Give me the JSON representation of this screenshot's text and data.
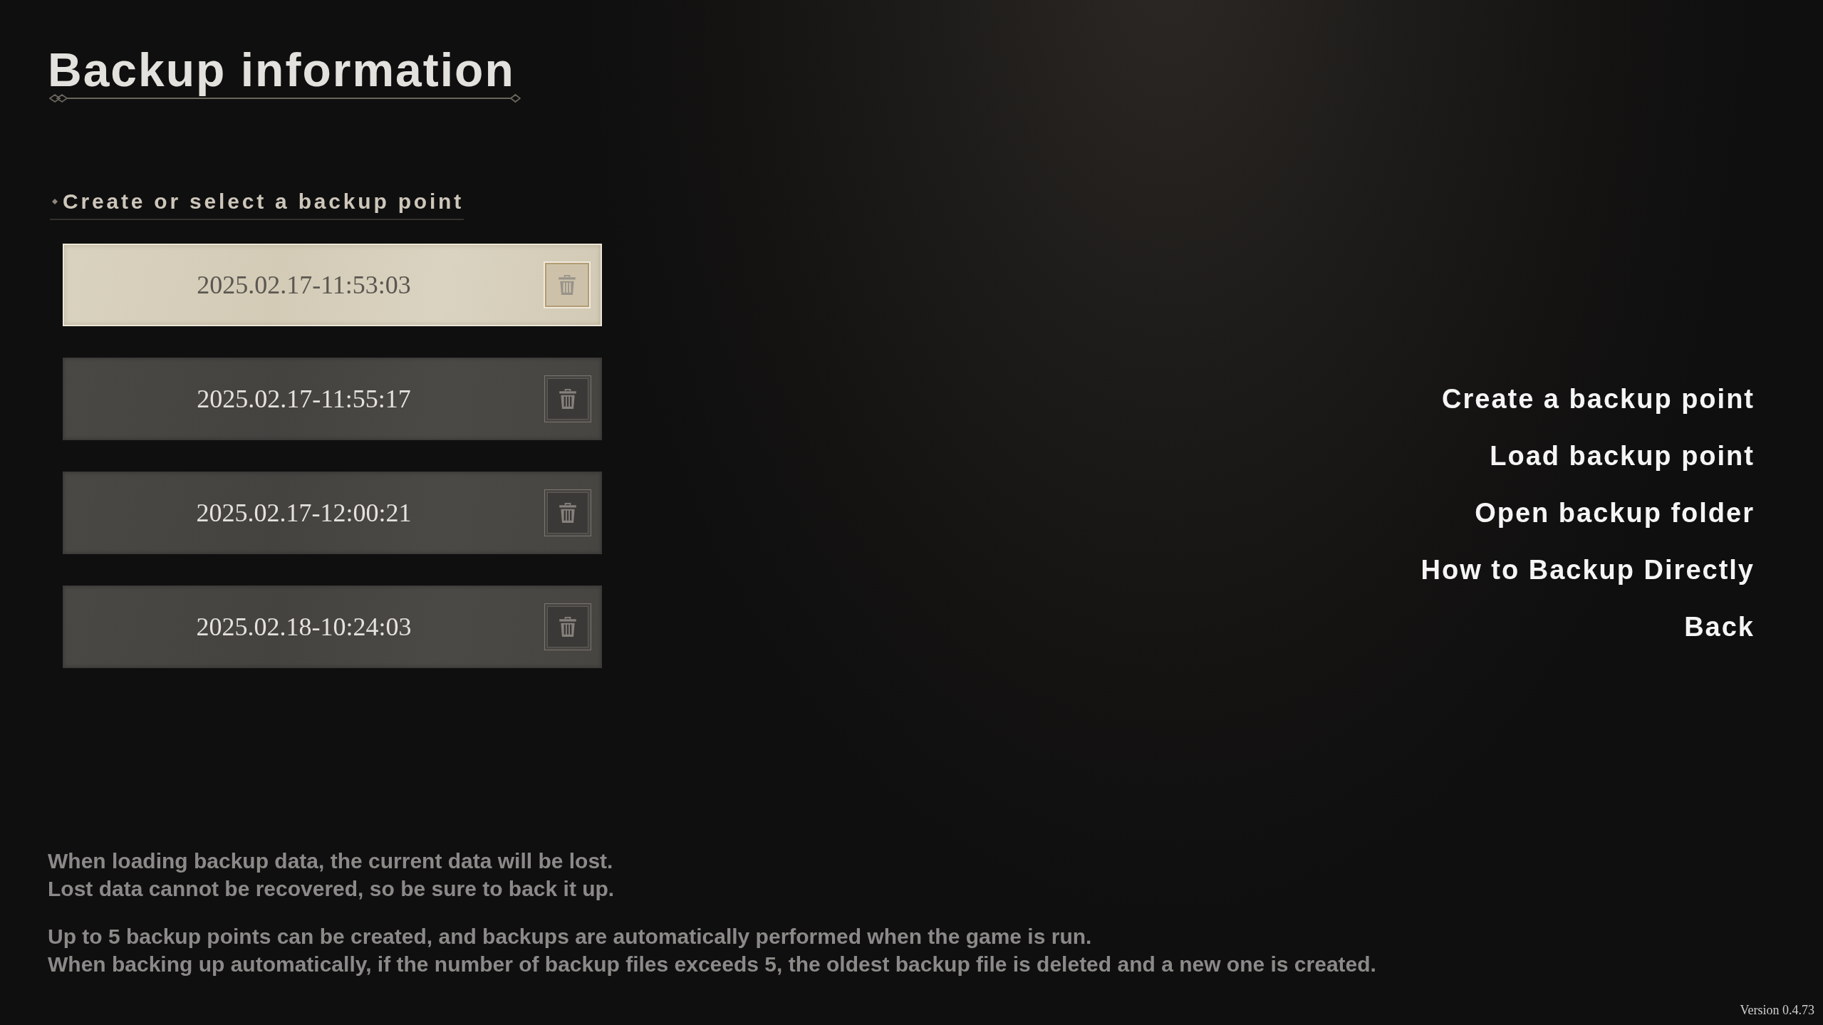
{
  "title": "Backup information",
  "backup_section": {
    "heading": "Create or select a backup point",
    "backup_points": [
      {
        "timestamp": "2025.02.17-11:53:03",
        "selected": true
      },
      {
        "timestamp": "2025.02.17-11:55:17",
        "selected": false
      },
      {
        "timestamp": "2025.02.17-12:00:21",
        "selected": false
      },
      {
        "timestamp": "2025.02.18-10:24:03",
        "selected": false
      }
    ]
  },
  "menu": [
    "Create a backup point",
    "Load backup point",
    "Open backup folder",
    "How to Backup Directly",
    "Back"
  ],
  "notes": [
    {
      "lines": [
        "When loading backup data, the current data will be lost.",
        "Lost data cannot be recovered, so be sure to back it up."
      ]
    },
    {
      "lines": [
        "Up to 5 backup points can be created, and backups are automatically performed when the game is run.",
        "When backing up automatically, if the number of backup files exceeds 5, the oldest backup file is deleted and a new one is created."
      ]
    }
  ],
  "version": "Version 0.4.73"
}
